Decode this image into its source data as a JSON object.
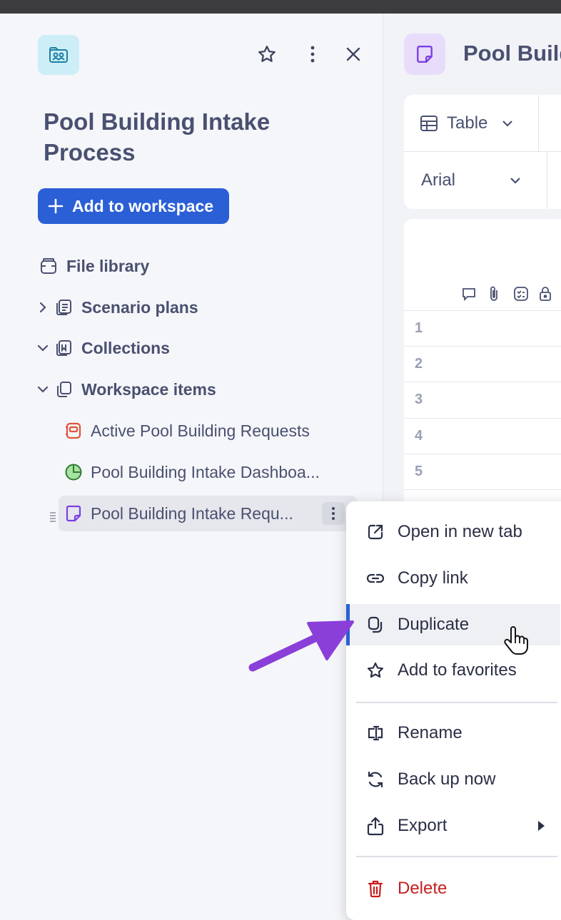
{
  "sidebar": {
    "header": {
      "workspace_icon": "workspace-people-icon",
      "star_icon": "star-icon",
      "more_icon": "more-vertical-icon",
      "close_icon": "close-icon"
    },
    "title": "Pool Building Intake Process",
    "add_button_label": "Add to workspace",
    "tree": [
      {
        "label": "File library",
        "icon": "file-library-icon"
      },
      {
        "label": "Scenario plans",
        "icon": "scenario-plans-icon",
        "chevron": "right"
      },
      {
        "label": "Collections",
        "icon": "collections-icon",
        "chevron": "down"
      },
      {
        "label": "Workspace items",
        "icon": "workspace-items-icon",
        "chevron": "down"
      }
    ],
    "items": [
      {
        "label": "Active Pool Building Requests",
        "icon": "form-icon",
        "color": "#e0533d"
      },
      {
        "label": "Pool Building Intake Dashboa...",
        "icon": "dashboard-icon",
        "color": "#2f9e44"
      },
      {
        "label": "Pool Building Intake Requ...",
        "icon": "sheet-icon",
        "color": "#7b3fe4"
      }
    ]
  },
  "document": {
    "title": "Pool Build",
    "view_label": "Table",
    "font_label": "Arial",
    "row_numbers": [
      "1",
      "2",
      "3",
      "4",
      "5"
    ]
  },
  "context_menu": {
    "items": [
      {
        "label": "Open in new tab",
        "icon": "external-link-icon"
      },
      {
        "label": "Copy link",
        "icon": "link-icon"
      },
      {
        "label": "Duplicate",
        "icon": "duplicate-icon"
      },
      {
        "label": "Add to favorites",
        "icon": "star-icon"
      },
      {
        "label": "Rename",
        "icon": "rename-icon"
      },
      {
        "label": "Back up now",
        "icon": "refresh-icon"
      },
      {
        "label": "Export",
        "icon": "share-icon"
      },
      {
        "label": "Delete",
        "icon": "trash-icon"
      }
    ],
    "hovered": "Duplicate"
  },
  "colors": {
    "accent": "#2a5fd6",
    "annotation_arrow": "#8a3fd8",
    "danger": "#c81e1e"
  }
}
